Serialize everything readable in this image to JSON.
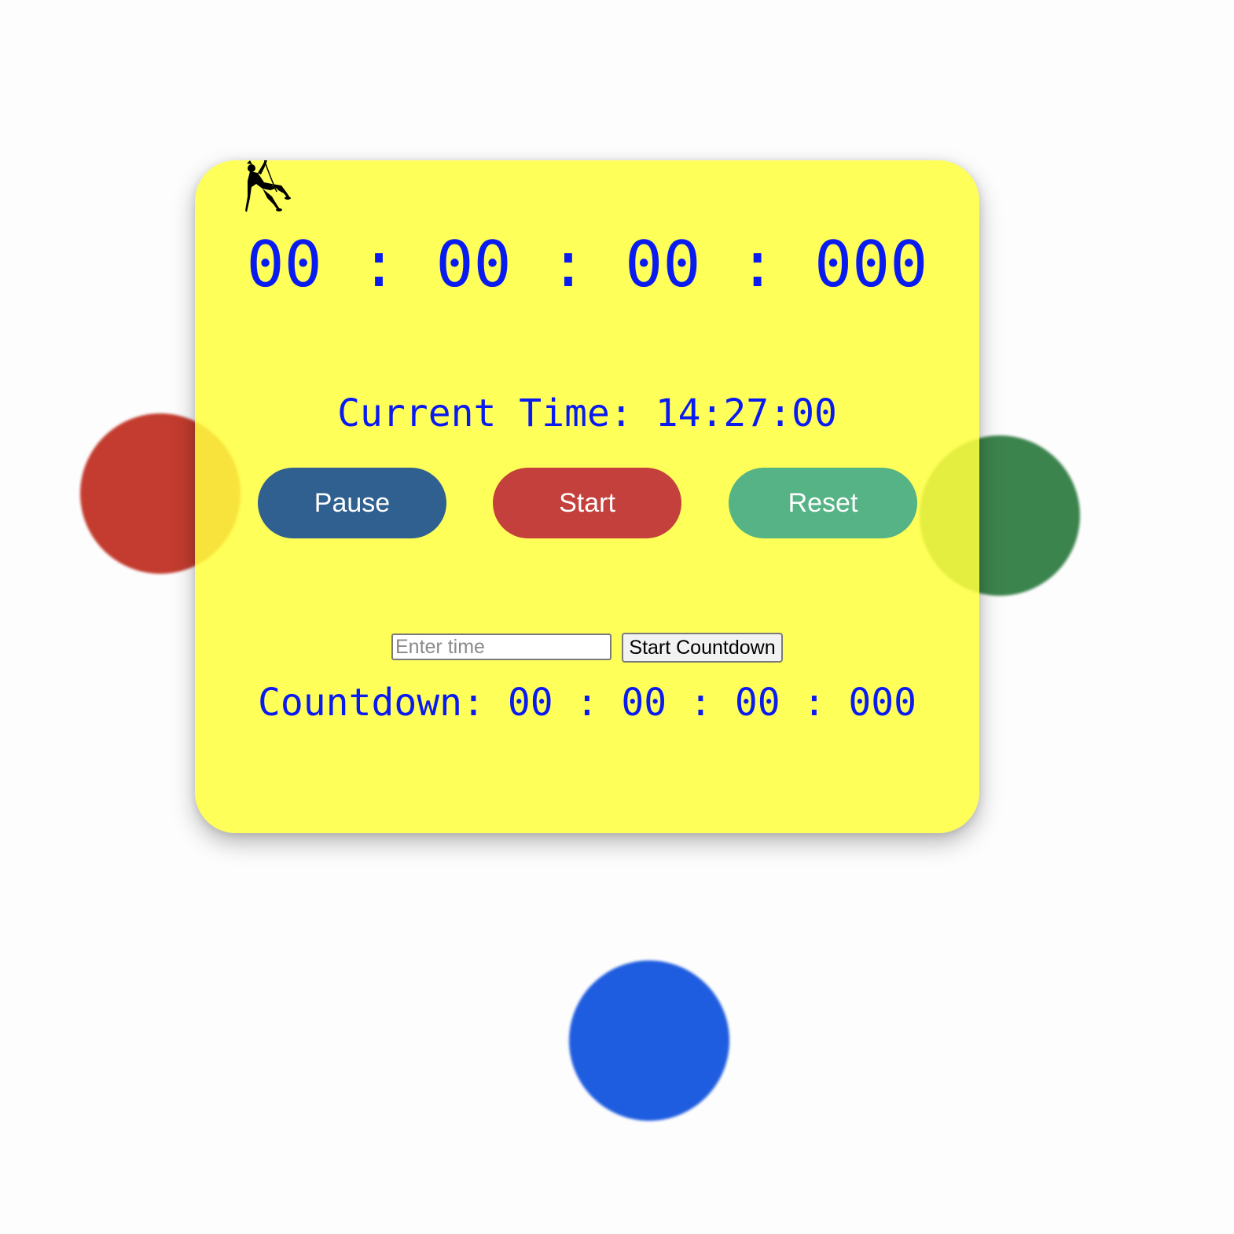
{
  "stopwatch": {
    "display": "00 : 00 : 00 : 000"
  },
  "clock": {
    "label": "Current Time:",
    "value": "14:27:00"
  },
  "controls": {
    "pause_label": "Pause",
    "start_label": "Start",
    "reset_label": "Reset"
  },
  "countdown": {
    "input_value": "",
    "input_placeholder": "Enter time",
    "button_label": "Start Countdown",
    "label": "Countdown:",
    "display": "00 : 00 : 00 : 000"
  },
  "colors": {
    "card_background": "#ffff3e",
    "digits": "#0a1bf0",
    "pause_button": "#30608f",
    "start_button": "#c4403c",
    "reset_button": "#55b385",
    "blob_red": "#c33c2f",
    "blob_green": "#3c844d",
    "blob_blue": "#1f5de0"
  },
  "icons": {
    "logo": "climber-icon"
  }
}
